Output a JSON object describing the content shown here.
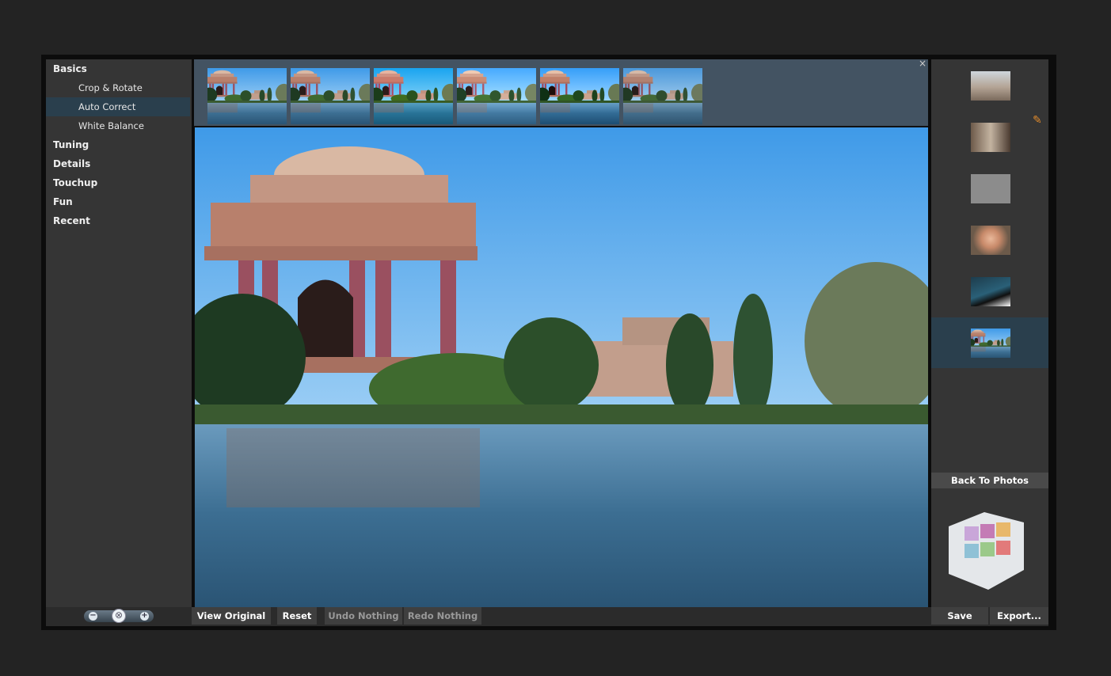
{
  "sidebar": {
    "categories": [
      {
        "label": "Basics"
      },
      {
        "label": "Tuning"
      },
      {
        "label": "Details"
      },
      {
        "label": "Touchup"
      },
      {
        "label": "Fun"
      },
      {
        "label": "Recent"
      }
    ],
    "basics_items": [
      {
        "label": "Crop & Rotate"
      },
      {
        "label": "Auto Correct",
        "selected": true
      },
      {
        "label": "White Balance"
      }
    ]
  },
  "filmstrip": {
    "close_icon": "close-icon",
    "thumbnail_count": 6
  },
  "right_panel": {
    "thumbnails": [
      "street-photo",
      "child-photo",
      "gray-photo",
      "boy-portrait",
      "dark-photo",
      "palace-photo"
    ],
    "selected_index": 5,
    "back_to_photos": "Back To Photos",
    "edit_icon": "pencil-icon",
    "logo": "adobe-cs-cube-icon"
  },
  "bottom_bar": {
    "view_original": "View Original",
    "reset": "Reset",
    "undo": "Undo Nothing",
    "redo": "Redo Nothing",
    "save": "Save",
    "export": "Export...",
    "zoom_out_icon": "zoom-out-icon",
    "zoom_fit_icon": "zoom-fit-icon",
    "zoom_in_icon": "zoom-in-icon"
  },
  "colors": {
    "selection": "#2a3f4d",
    "filmstrip_bg": "#435362",
    "panel_bg": "#353535"
  }
}
